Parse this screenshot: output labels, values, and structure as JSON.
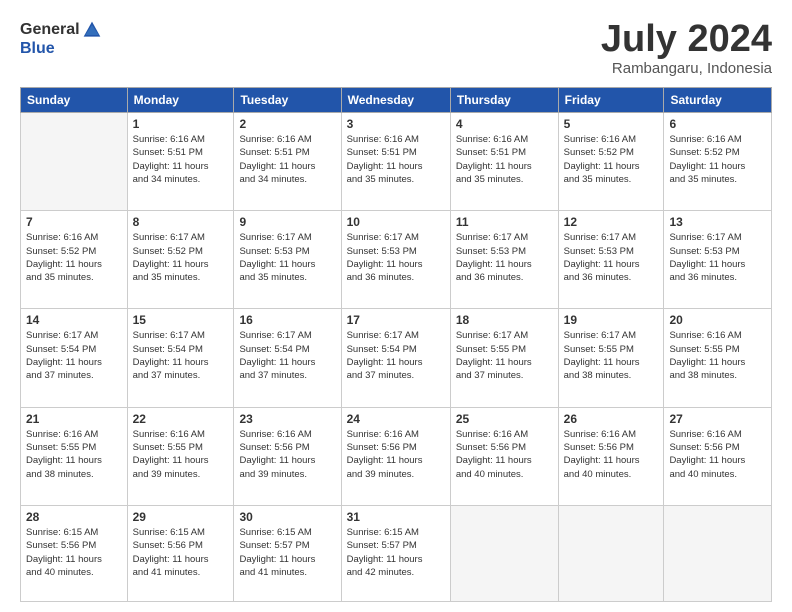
{
  "header": {
    "logo_general": "General",
    "logo_blue": "Blue",
    "month_title": "July 2024",
    "location": "Rambangaru, Indonesia"
  },
  "days_of_week": [
    "Sunday",
    "Monday",
    "Tuesday",
    "Wednesday",
    "Thursday",
    "Friday",
    "Saturday"
  ],
  "weeks": [
    [
      {
        "day": "",
        "info": ""
      },
      {
        "day": "1",
        "info": "Sunrise: 6:16 AM\nSunset: 5:51 PM\nDaylight: 11 hours\nand 34 minutes."
      },
      {
        "day": "2",
        "info": "Sunrise: 6:16 AM\nSunset: 5:51 PM\nDaylight: 11 hours\nand 34 minutes."
      },
      {
        "day": "3",
        "info": "Sunrise: 6:16 AM\nSunset: 5:51 PM\nDaylight: 11 hours\nand 35 minutes."
      },
      {
        "day": "4",
        "info": "Sunrise: 6:16 AM\nSunset: 5:51 PM\nDaylight: 11 hours\nand 35 minutes."
      },
      {
        "day": "5",
        "info": "Sunrise: 6:16 AM\nSunset: 5:52 PM\nDaylight: 11 hours\nand 35 minutes."
      },
      {
        "day": "6",
        "info": "Sunrise: 6:16 AM\nSunset: 5:52 PM\nDaylight: 11 hours\nand 35 minutes."
      }
    ],
    [
      {
        "day": "7",
        "info": "Sunrise: 6:16 AM\nSunset: 5:52 PM\nDaylight: 11 hours\nand 35 minutes."
      },
      {
        "day": "8",
        "info": "Sunrise: 6:17 AM\nSunset: 5:52 PM\nDaylight: 11 hours\nand 35 minutes."
      },
      {
        "day": "9",
        "info": "Sunrise: 6:17 AM\nSunset: 5:53 PM\nDaylight: 11 hours\nand 35 minutes."
      },
      {
        "day": "10",
        "info": "Sunrise: 6:17 AM\nSunset: 5:53 PM\nDaylight: 11 hours\nand 36 minutes."
      },
      {
        "day": "11",
        "info": "Sunrise: 6:17 AM\nSunset: 5:53 PM\nDaylight: 11 hours\nand 36 minutes."
      },
      {
        "day": "12",
        "info": "Sunrise: 6:17 AM\nSunset: 5:53 PM\nDaylight: 11 hours\nand 36 minutes."
      },
      {
        "day": "13",
        "info": "Sunrise: 6:17 AM\nSunset: 5:53 PM\nDaylight: 11 hours\nand 36 minutes."
      }
    ],
    [
      {
        "day": "14",
        "info": "Sunrise: 6:17 AM\nSunset: 5:54 PM\nDaylight: 11 hours\nand 37 minutes."
      },
      {
        "day": "15",
        "info": "Sunrise: 6:17 AM\nSunset: 5:54 PM\nDaylight: 11 hours\nand 37 minutes."
      },
      {
        "day": "16",
        "info": "Sunrise: 6:17 AM\nSunset: 5:54 PM\nDaylight: 11 hours\nand 37 minutes."
      },
      {
        "day": "17",
        "info": "Sunrise: 6:17 AM\nSunset: 5:54 PM\nDaylight: 11 hours\nand 37 minutes."
      },
      {
        "day": "18",
        "info": "Sunrise: 6:17 AM\nSunset: 5:55 PM\nDaylight: 11 hours\nand 37 minutes."
      },
      {
        "day": "19",
        "info": "Sunrise: 6:17 AM\nSunset: 5:55 PM\nDaylight: 11 hours\nand 38 minutes."
      },
      {
        "day": "20",
        "info": "Sunrise: 6:16 AM\nSunset: 5:55 PM\nDaylight: 11 hours\nand 38 minutes."
      }
    ],
    [
      {
        "day": "21",
        "info": "Sunrise: 6:16 AM\nSunset: 5:55 PM\nDaylight: 11 hours\nand 38 minutes."
      },
      {
        "day": "22",
        "info": "Sunrise: 6:16 AM\nSunset: 5:55 PM\nDaylight: 11 hours\nand 39 minutes."
      },
      {
        "day": "23",
        "info": "Sunrise: 6:16 AM\nSunset: 5:56 PM\nDaylight: 11 hours\nand 39 minutes."
      },
      {
        "day": "24",
        "info": "Sunrise: 6:16 AM\nSunset: 5:56 PM\nDaylight: 11 hours\nand 39 minutes."
      },
      {
        "day": "25",
        "info": "Sunrise: 6:16 AM\nSunset: 5:56 PM\nDaylight: 11 hours\nand 40 minutes."
      },
      {
        "day": "26",
        "info": "Sunrise: 6:16 AM\nSunset: 5:56 PM\nDaylight: 11 hours\nand 40 minutes."
      },
      {
        "day": "27",
        "info": "Sunrise: 6:16 AM\nSunset: 5:56 PM\nDaylight: 11 hours\nand 40 minutes."
      }
    ],
    [
      {
        "day": "28",
        "info": "Sunrise: 6:15 AM\nSunset: 5:56 PM\nDaylight: 11 hours\nand 40 minutes."
      },
      {
        "day": "29",
        "info": "Sunrise: 6:15 AM\nSunset: 5:56 PM\nDaylight: 11 hours\nand 41 minutes."
      },
      {
        "day": "30",
        "info": "Sunrise: 6:15 AM\nSunset: 5:57 PM\nDaylight: 11 hours\nand 41 minutes."
      },
      {
        "day": "31",
        "info": "Sunrise: 6:15 AM\nSunset: 5:57 PM\nDaylight: 11 hours\nand 42 minutes."
      },
      {
        "day": "",
        "info": ""
      },
      {
        "day": "",
        "info": ""
      },
      {
        "day": "",
        "info": ""
      }
    ]
  ]
}
